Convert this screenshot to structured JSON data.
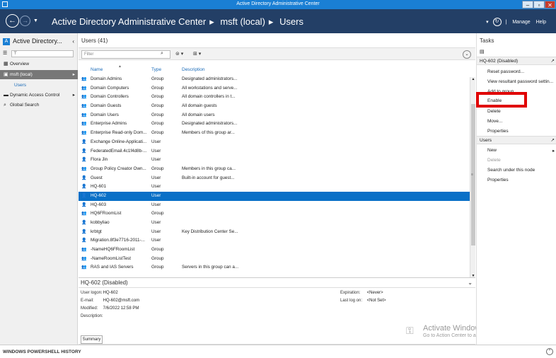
{
  "window": {
    "title": "Active Directory Administrative Center"
  },
  "header": {
    "breadcrumbs": [
      "Active Directory Administrative Center",
      "msft (local)",
      "Users"
    ],
    "manage_label": "Manage",
    "help_label": "Help"
  },
  "leftnav": {
    "title": "Active Directory...",
    "items": [
      {
        "label": "Overview"
      },
      {
        "label": "msft (local)"
      },
      {
        "label": "Users"
      },
      {
        "label": "Dynamic Access Control"
      },
      {
        "label": "Global Search"
      }
    ]
  },
  "center": {
    "title": "Users  (41)",
    "filter_placeholder": "Filter",
    "columns": [
      "Name",
      "Type",
      "Description"
    ],
    "rows": [
      {
        "name": "Domain Admins",
        "type": "Group",
        "desc": "Designated administrators..."
      },
      {
        "name": "Domain Computers",
        "type": "Group",
        "desc": "All workstations and serve..."
      },
      {
        "name": "Domain Controllers",
        "type": "Group",
        "desc": "All domain controllers in t..."
      },
      {
        "name": "Domain Guests",
        "type": "Group",
        "desc": "All domain guests"
      },
      {
        "name": "Domain Users",
        "type": "Group",
        "desc": "All domain users"
      },
      {
        "name": "Enterprise Admins",
        "type": "Group",
        "desc": "Designated administrators..."
      },
      {
        "name": "Enterprise Read-only Dom...",
        "type": "Group",
        "desc": "Members of this group ar..."
      },
      {
        "name": "Exchange Online-Applicati...",
        "type": "User",
        "desc": ""
      },
      {
        "name": "FederatedEmail.4c1f4d8b-...",
        "type": "User",
        "desc": ""
      },
      {
        "name": "Flora Jin",
        "type": "User",
        "desc": ""
      },
      {
        "name": "Group Policy Creator Own...",
        "type": "Group",
        "desc": "Members in this group ca..."
      },
      {
        "name": "Guest",
        "type": "User",
        "desc": "Built-in account for guest..."
      },
      {
        "name": "HQ-601",
        "type": "User",
        "desc": ""
      },
      {
        "name": "HQ-602",
        "type": "User",
        "desc": ""
      },
      {
        "name": "HQ-603",
        "type": "User",
        "desc": ""
      },
      {
        "name": "HQ6FRoomList",
        "type": "Group",
        "desc": ""
      },
      {
        "name": "kobbyliao",
        "type": "User",
        "desc": ""
      },
      {
        "name": "krbtgt",
        "type": "User",
        "desc": "Key Distribution Center Se..."
      },
      {
        "name": "Migration.8f3e7716-2011-...",
        "type": "User",
        "desc": ""
      },
      {
        "name": "-NameHQ6FRoomList",
        "type": "Group",
        "desc": ""
      },
      {
        "name": "-NameRoomListTest",
        "type": "Group",
        "desc": ""
      },
      {
        "name": "RAS and IAS Servers",
        "type": "Group",
        "desc": "Servers in this group can a..."
      }
    ],
    "selected_row_name": "HQ-602"
  },
  "preview": {
    "title": "HQ-602 (Disabled)",
    "user_logon_label": "User logon:",
    "user_logon": "HQ-602",
    "email_label": "E-mail:",
    "email": "HQ-602@msft.com",
    "modified_label": "Modified:",
    "modified": "7/6/2022 12:58 PM",
    "description_label": "Description:",
    "expiration_label": "Expiration:",
    "expiration": "<Never>",
    "last_logon_label": "Last log on:",
    "last_logon": "<Not Set>",
    "summary_button": "Summary"
  },
  "tasks": {
    "title": "Tasks",
    "section1_title": "HQ-602 (Disabled)",
    "section1_items": [
      "Reset password...",
      "View resultant password settin...",
      "Add to group...",
      "Enable",
      "Delete",
      "Move...",
      "Properties"
    ],
    "section2_title": "Users",
    "section2_items": [
      "New",
      "Delete",
      "Search under this node",
      "Properties"
    ]
  },
  "watermark": {
    "line1": "Activate Windows",
    "line2": "Go to Action Center to activate Windows."
  },
  "powershell": {
    "title": "WINDOWS POWERSHELL HISTORY"
  },
  "colors": {
    "header": "#233f66",
    "titlebar": "#1a7fd4",
    "selection": "#0a70c7",
    "highlight": "#e00000"
  }
}
